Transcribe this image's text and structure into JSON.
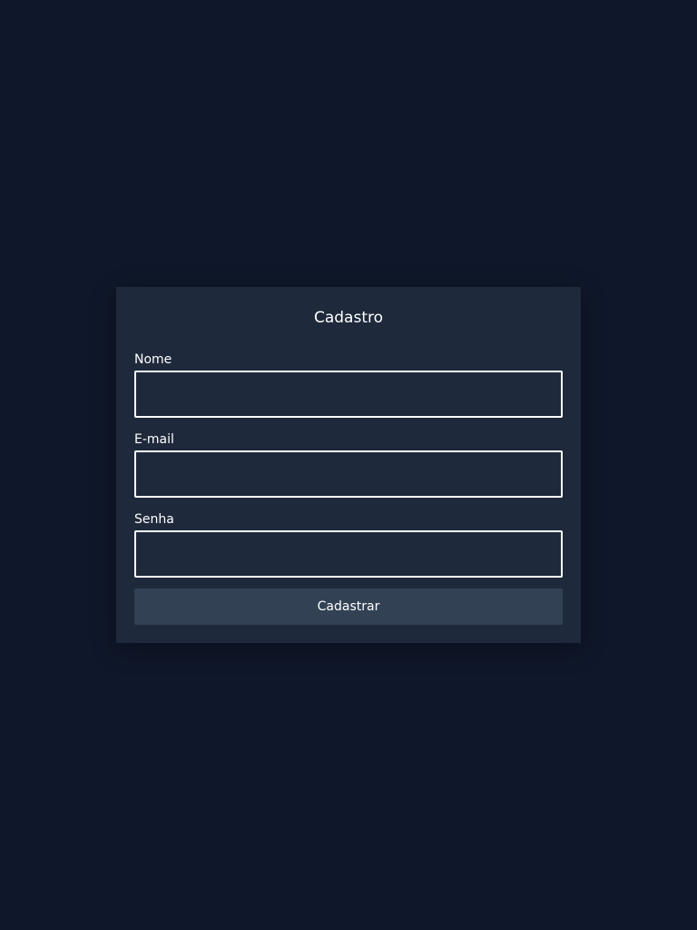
{
  "form": {
    "title": "Cadastro",
    "fields": [
      {
        "label": "Nome",
        "value": "",
        "placeholder": ""
      },
      {
        "label": "E-mail",
        "value": "",
        "placeholder": ""
      },
      {
        "label": "Senha",
        "value": "",
        "placeholder": ""
      }
    ],
    "submit_label": "Cadastrar"
  },
  "colors": {
    "background": "#0f172a",
    "card": "#1e293b",
    "button": "#334155",
    "text": "#ffffff",
    "input_border": "#ffffff"
  }
}
